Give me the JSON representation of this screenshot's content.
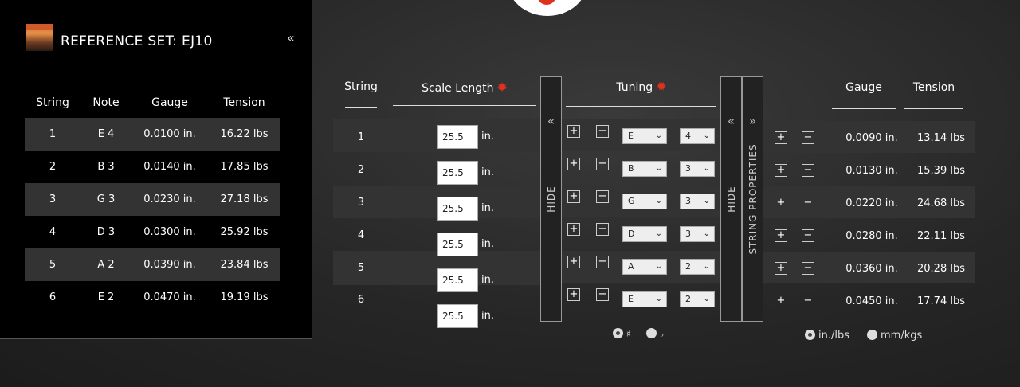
{
  "reference": {
    "title": "REFERENCE SET: EJ10",
    "collapse_icon": "«",
    "headers": {
      "string": "String",
      "note": "Note",
      "gauge": "Gauge",
      "tension": "Tension"
    },
    "rows": [
      {
        "string": "1",
        "note": "E 4",
        "gauge": "0.0100 in.",
        "tension": "16.22 lbs"
      },
      {
        "string": "2",
        "note": "B 3",
        "gauge": "0.0140 in.",
        "tension": "17.85 lbs"
      },
      {
        "string": "3",
        "note": "G 3",
        "gauge": "0.0230 in.",
        "tension": "27.18 lbs"
      },
      {
        "string": "4",
        "note": "D 3",
        "gauge": "0.0300 in.",
        "tension": "25.92 lbs"
      },
      {
        "string": "5",
        "note": "A 2",
        "gauge": "0.0390 in.",
        "tension": "23.84 lbs"
      },
      {
        "string": "6",
        "note": "E 2",
        "gauge": "0.0470 in.",
        "tension": "19.19 lbs"
      }
    ]
  },
  "main": {
    "headers": {
      "string": "String",
      "scale_length": "Scale Length",
      "tuning": "Tuning",
      "gauge": "Gauge",
      "tension": "Tension"
    },
    "gear_icon": "✹",
    "unit_label": "in.",
    "hide_label": "HIDE",
    "string_properties_label": "STRING PROPERTIES",
    "left_chevron": "«",
    "right_chevron": "»",
    "plus": "+",
    "minus": "−",
    "rows": [
      {
        "string": "1",
        "scale": "25.5",
        "note": "E",
        "octave": "4",
        "gauge": "0.0090 in.",
        "tension": "13.14 lbs"
      },
      {
        "string": "2",
        "scale": "25.5",
        "note": "B",
        "octave": "3",
        "gauge": "0.0130 in.",
        "tension": "15.39 lbs"
      },
      {
        "string": "3",
        "scale": "25.5",
        "note": "G",
        "octave": "3",
        "gauge": "0.0220 in.",
        "tension": "24.68 lbs"
      },
      {
        "string": "4",
        "scale": "25.5",
        "note": "D",
        "octave": "3",
        "gauge": "0.0280 in.",
        "tension": "22.11 lbs"
      },
      {
        "string": "5",
        "scale": "25.5",
        "note": "A",
        "octave": "2",
        "gauge": "0.0360 in.",
        "tension": "20.28 lbs"
      },
      {
        "string": "6",
        "scale": "25.5",
        "note": "E",
        "octave": "2",
        "gauge": "0.0450 in.",
        "tension": "17.74 lbs"
      }
    ],
    "accidental": {
      "sharp": "♯",
      "flat": "♭",
      "selected": "sharp"
    },
    "units": {
      "imperial": "in./lbs",
      "metric": "mm/kgs",
      "selected": "imperial"
    },
    "select_arrow": "⌄"
  }
}
